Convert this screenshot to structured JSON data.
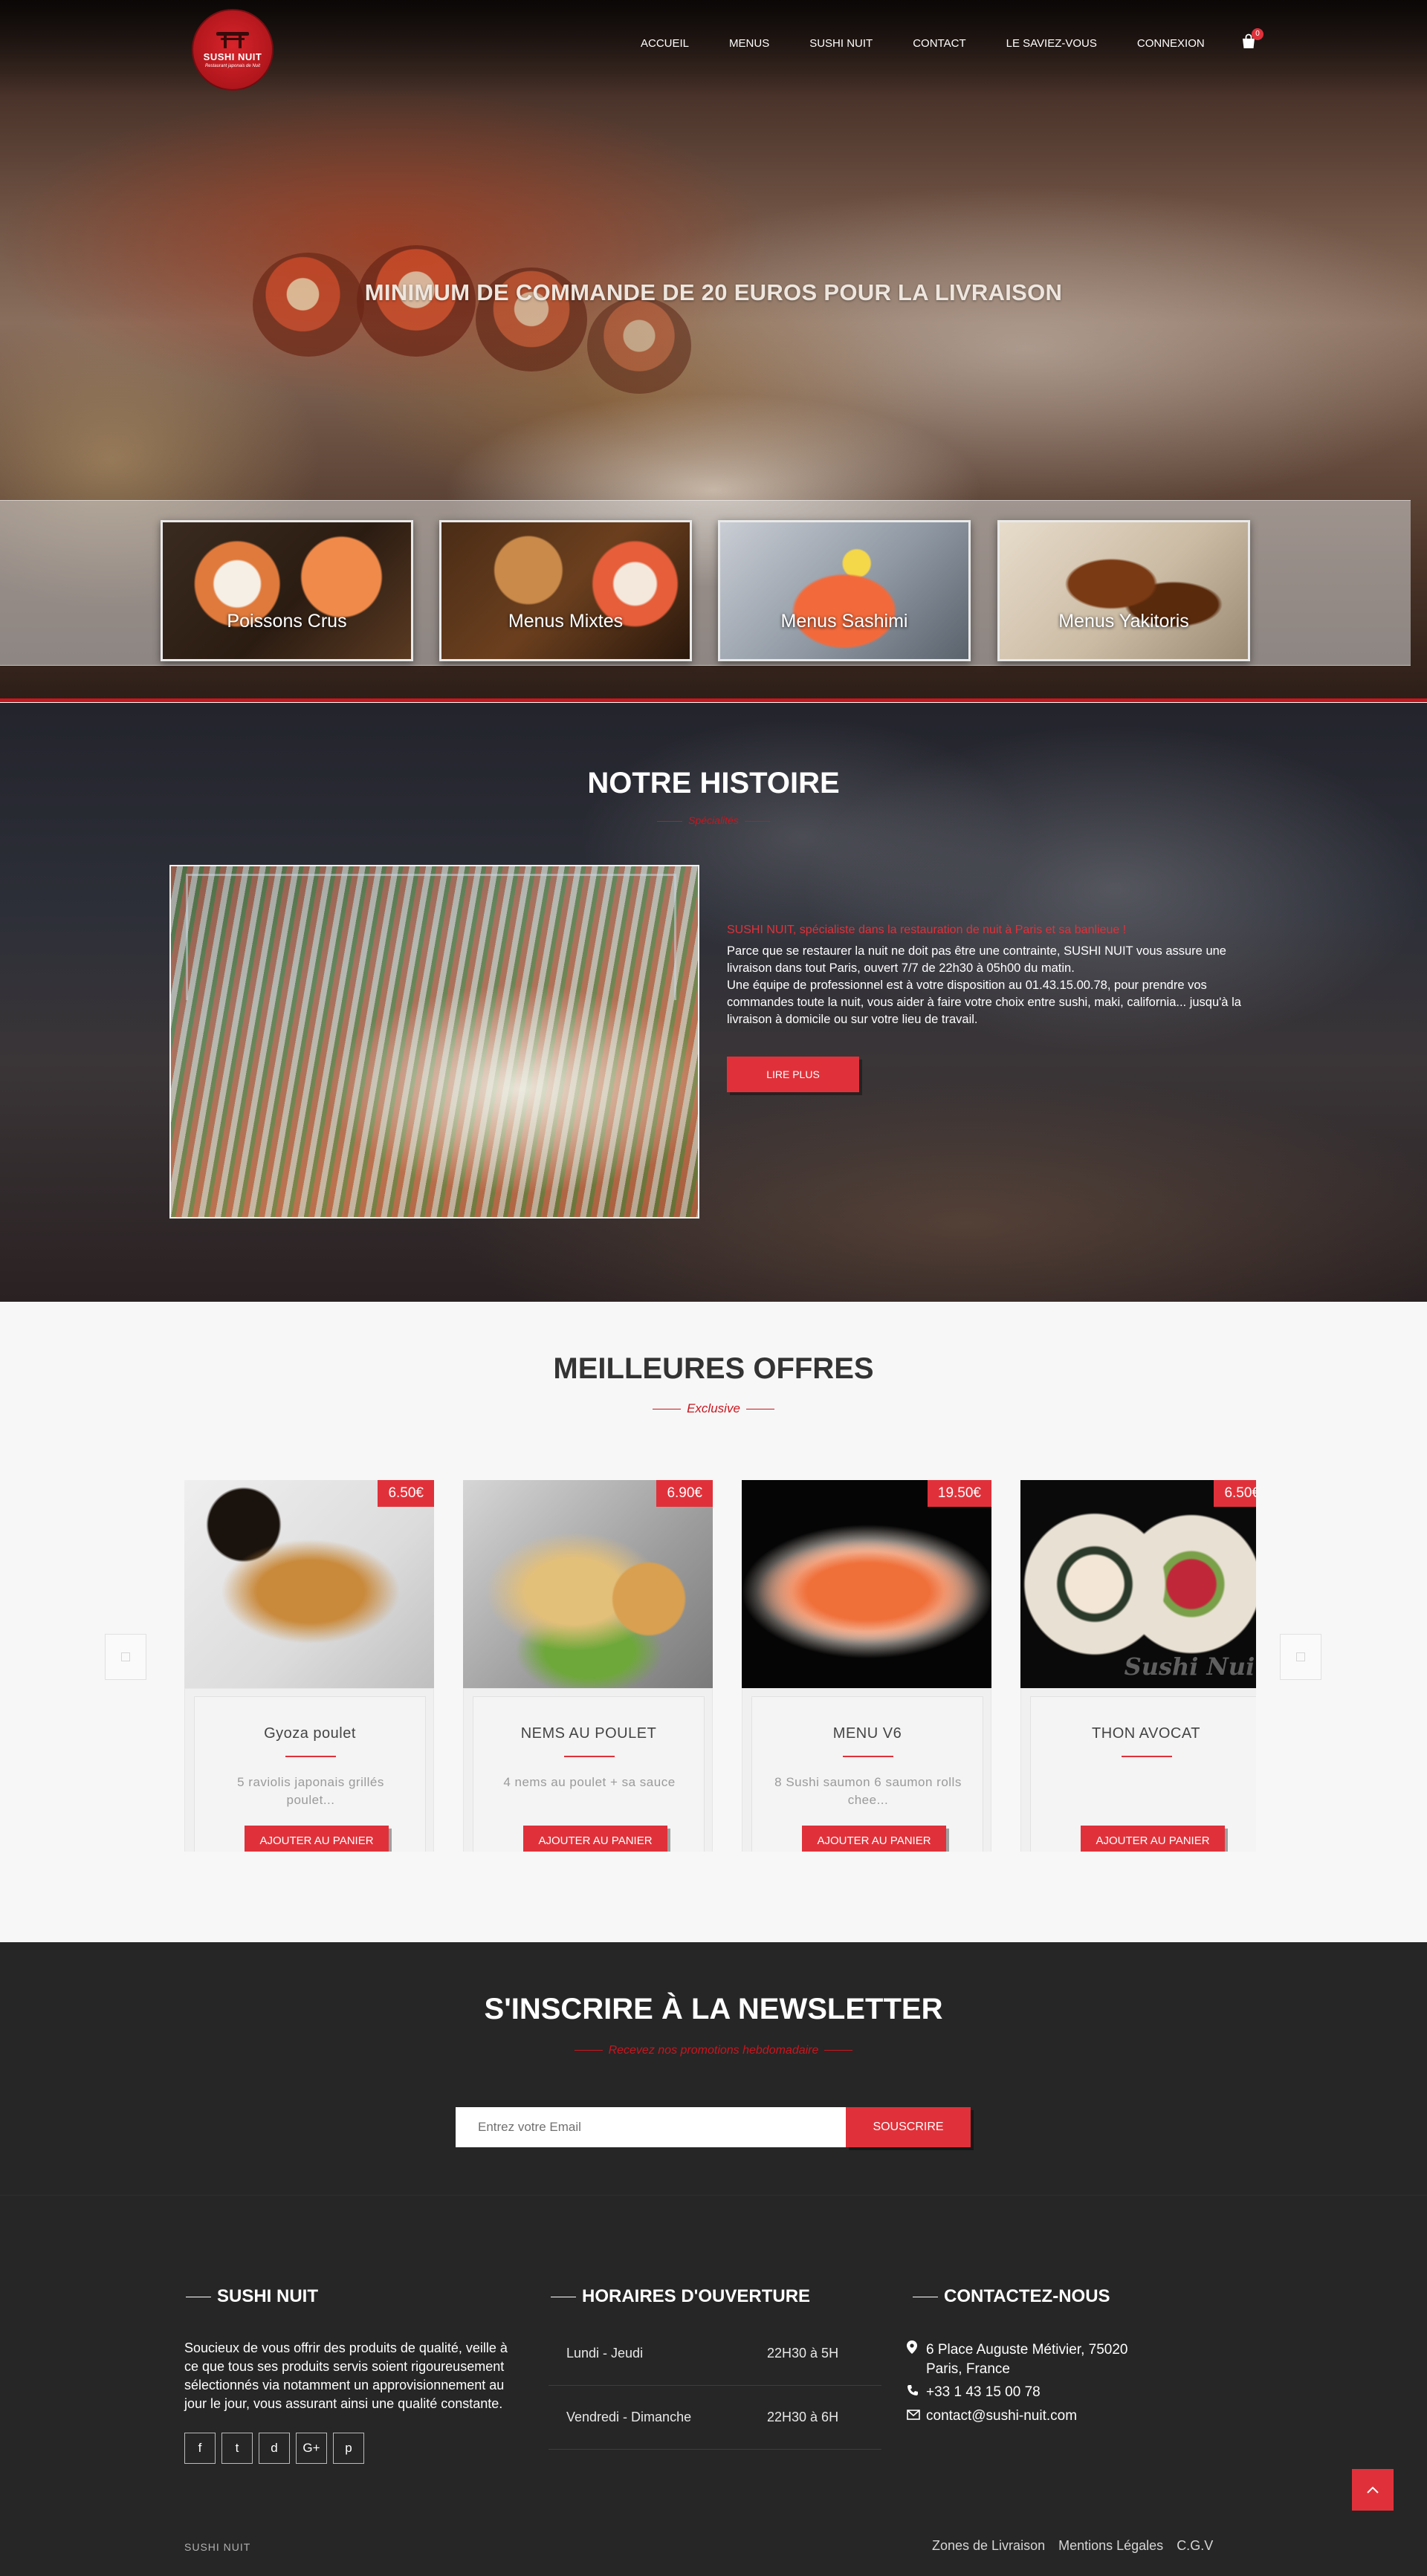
{
  "brand": {
    "name": "SUSHI NUIT",
    "tagline": "Restaurant japonais de Nuit"
  },
  "nav": {
    "items": [
      "ACCUEIL",
      "MENUS",
      "SUSHI NUIT",
      "CONTACT",
      "LE SAVIEZ-VOUS",
      "CONNEXION"
    ],
    "cart_count": "0"
  },
  "hero": {
    "title": "MINIMUM DE COMMANDE DE 20 EUROS POUR LA LIVRAISON",
    "categories": [
      "Poissons Crus",
      "Menus Mixtes",
      "Menus Sashimi",
      "Menus Yakitoris"
    ]
  },
  "histoire": {
    "title": "NOTRE HISTOIRE",
    "subtitle": "Spécialités",
    "lead": "SUSHI NUIT, spécialiste dans la restauration de nuit à  Paris et sa banlieue !",
    "paragraph1": "Parce que se restaurer la nuit ne doit pas être une contrainte, SUSHI NUIT vous assure une livraison dans tout Paris, ouvert 7/7 de 22h30 à 05h00 du matin.",
    "paragraph2": "Une équipe de professionnel est à votre disposition au 01.43.15.00.78, pour prendre vos commandes toute la nuit, vous aider à faire votre choix entre sushi, maki, california... jusqu'à la livraison à domicile ou sur votre lieu de travail.",
    "button": "LIRE PLUS"
  },
  "offres": {
    "title": "MEILLEURES OFFRES",
    "subtitle": "Exclusive",
    "products": [
      {
        "price": "6.50€",
        "name": "Gyoza poulet",
        "desc": "5 raviolis japonais grillés poulet...",
        "button": "AJOUTER AU PANIER"
      },
      {
        "price": "6.90€",
        "name": "NEMS AU POULET",
        "desc": "4 nems au poulet + sa sauce",
        "button": "AJOUTER AU PANIER"
      },
      {
        "price": "19.50€",
        "name": "MENU V6",
        "desc": "8 Sushi saumon 6 saumon rolls chee...",
        "button": "AJOUTER AU PANIER"
      },
      {
        "price": "6.50€",
        "name": "THON AVOCAT",
        "desc": "",
        "button": "AJOUTER AU PANIER"
      }
    ],
    "watermark": "Sushi Nuit"
  },
  "newsletter": {
    "title": "S'INSCRIRE À LA NEWSLETTER",
    "subtitle": "Recevez nos promotions hebdomadaire",
    "placeholder": "Entrez votre Email",
    "button": "SOUSCRIRE"
  },
  "footer": {
    "about_title": "SUSHI NUIT",
    "about_text": "Soucieux de vous offrir des produits de qualité, veille à ce que tous ses produits servis soient rigoureusement sélectionnés via notamment un approvisionnement au jour le jour, vous assurant ainsi une qualité constante.",
    "socials": [
      "f",
      "t",
      "d",
      "G+",
      "p"
    ],
    "hours_title": "HORAIRES D'OUVERTURE",
    "hours": [
      {
        "day": "Lundi - Jeudi",
        "time": "22H30 à 5H"
      },
      {
        "day": "Vendredi - Dimanche",
        "time": "22H30 à 6H"
      }
    ],
    "contact_title": "CONTACTEZ-NOUS",
    "address_line1": "6 Place Auguste Métivier, 75020",
    "address_line2": "Paris, France",
    "phone": "+33 1 43 15 00 78",
    "email": "contact@sushi-nuit.com",
    "brand_bottom": "SUSHI NUIT",
    "links": [
      "Zones de Livraison",
      "Mentions Légales",
      "C.G.V"
    ]
  },
  "colors": {
    "accent": "#e0313a",
    "dark_red": "#c8161e",
    "dark_bg": "#262626"
  },
  "icons": [
    "cart-icon",
    "map-marker-icon",
    "phone-icon",
    "envelope-icon",
    "chevron-up-icon",
    "chevron-left-icon",
    "chevron-right-icon",
    "facebook-icon",
    "twitter-icon",
    "dribbble-icon",
    "google-plus-icon",
    "pinterest-icon"
  ]
}
